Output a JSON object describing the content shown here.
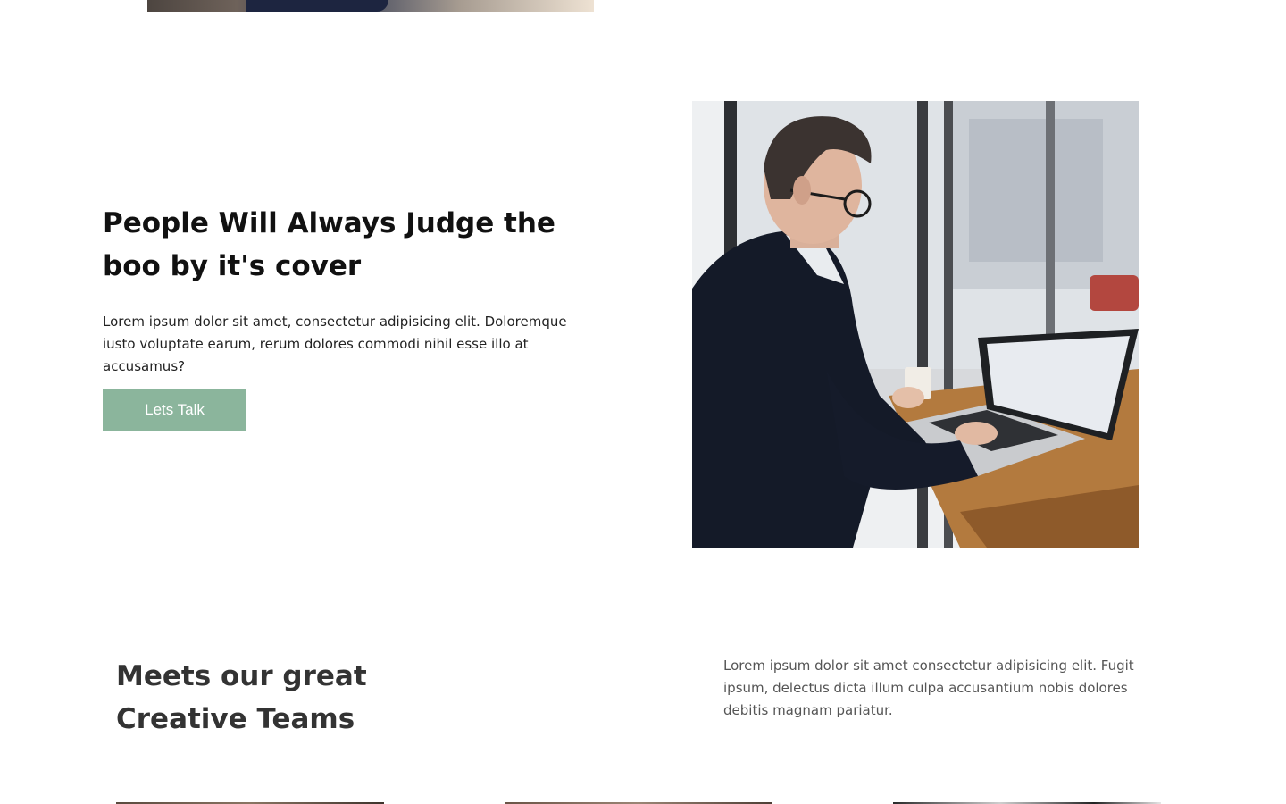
{
  "hero": {
    "title": "People Will Always Judge the boo by it's cover",
    "description": "Lorem ipsum dolor sit amet, consectetur adipisicing elit. Doloremque iusto voluptate earum, rerum dolores commodi nihil esse illo at accusamus?",
    "button_label": "Lets Talk",
    "accent_color": "#8bb59c",
    "photo": "man-working-on-laptop-by-cafe-window"
  },
  "teams": {
    "title": "Meets our great Creative Teams",
    "description": "Lorem ipsum dolor sit amet consectetur adipisicing elit. Fugit ipsum, delectus dicta illum culpa accusantium nobis dolores debitis magnam pariatur."
  }
}
